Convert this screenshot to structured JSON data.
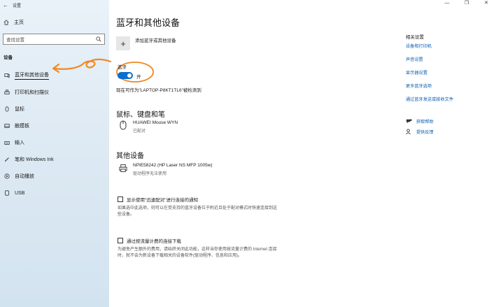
{
  "window": {
    "title": "设置",
    "back_glyph": "←",
    "controls": [
      "—",
      "❐",
      "✕"
    ]
  },
  "sidebar": {
    "home_label": "主页",
    "search_placeholder": "查找设置",
    "section_label": "设备",
    "items": [
      {
        "label": "蓝牙和其他设备",
        "icon": "bluetooth-devices-icon"
      },
      {
        "label": "打印机和扫描仪",
        "icon": "printer-icon"
      },
      {
        "label": "鼠标",
        "icon": "mouse-icon"
      },
      {
        "label": "触摸板",
        "icon": "touchpad-icon"
      },
      {
        "label": "输入",
        "icon": "keyboard-icon"
      },
      {
        "label": "笔和 Windows Ink",
        "icon": "pen-icon"
      },
      {
        "label": "自动播放",
        "icon": "autoplay-icon"
      },
      {
        "label": "USB",
        "icon": "usb-icon"
      }
    ]
  },
  "main": {
    "title": "蓝牙和其他设备",
    "add_device_label": "添加蓝牙或其他设备",
    "bluetooth_label": "蓝牙",
    "toggle_state": "开",
    "discoverable_text": "现在可作为\"LAPTOP-P8KT1TL6\"被检测到",
    "mouse_section": {
      "title": "鼠标、键盘和笔",
      "devices": [
        {
          "name": "HUAWEI Mouse WYN",
          "status": "已配对"
        }
      ]
    },
    "other_section": {
      "title": "其他设备",
      "devices": [
        {
          "name": "NPIE58242 (HP Laser NS MFP 1005w)",
          "status": "驱动程序无法使用"
        }
      ]
    },
    "swift_pair": {
      "label": "显示使用\"迅速配对\"进行连接的通知",
      "description": "如果选中此选项，则可以在受支持的蓝牙设备位于附近且处于配对模式时快速连接到这些设备。"
    },
    "metered": {
      "label": "通过按流量计费的连接下载",
      "description": "为避免产生额外的费用，请始终关闭此功能，这样当你使用按流量计费的 Internet 连接时，就不会为新设备下载相关的设备软件(驱动程序、信息和应用)。"
    }
  },
  "related": {
    "title": "相关设置",
    "links": [
      "设备和打印机",
      "声音设置",
      "显示器设置",
      "更多蓝牙选项",
      "通过蓝牙发送或接收文件"
    ],
    "help": [
      {
        "label": "获取帮助",
        "icon": "help-chat-icon"
      },
      {
        "label": "提供反馈",
        "icon": "feedback-icon"
      }
    ]
  },
  "colors": {
    "accent": "#0a6ed1",
    "annotation": "#f08a24",
    "link": "#0a5fb5"
  }
}
